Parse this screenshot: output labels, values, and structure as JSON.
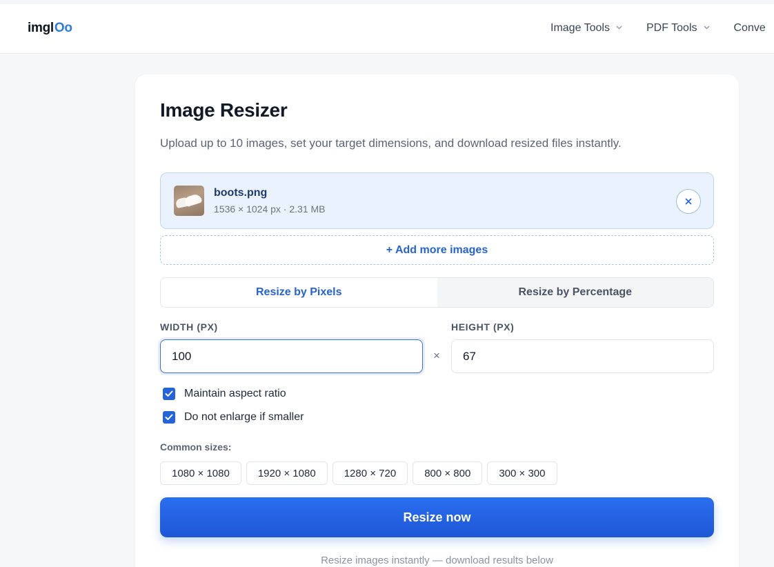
{
  "header": {
    "logo_prefix": "imgl",
    "logo_suffix": "Oo",
    "nav": [
      {
        "label": "Image Tools"
      },
      {
        "label": "PDF Tools"
      },
      {
        "label": "Conve"
      }
    ]
  },
  "main": {
    "title": "Image Resizer",
    "subtitle": "Upload up to 10 images, set your target dimensions, and download resized files instantly.",
    "file": {
      "name": "boots.png",
      "meta": "1536 × 1024 px · 2.31 MB"
    },
    "add_more_label": "+ Add more images",
    "tabs": [
      {
        "label": "Resize by Pixels",
        "active": true
      },
      {
        "label": "Resize by Percentage",
        "active": false
      }
    ],
    "width_label": "WIDTH (PX)",
    "height_label": "HEIGHT (PX)",
    "width_value": "100",
    "height_value": "67",
    "times_symbol": "×",
    "options": [
      {
        "label": "Maintain aspect ratio",
        "checked": true
      },
      {
        "label": "Do not enlarge if smaller",
        "checked": true
      }
    ],
    "common_sizes_label": "Common sizes:",
    "common_sizes": [
      "1080 × 1080",
      "1920 × 1080",
      "1280 × 720",
      "800 × 800",
      "300 × 300"
    ],
    "resize_button": "Resize now",
    "footnote": "Resize images instantly — download results below"
  },
  "colors": {
    "accent": "#2563d9",
    "file_row_bg": "#eaf3fd",
    "page_bg": "#f6f7f9"
  }
}
